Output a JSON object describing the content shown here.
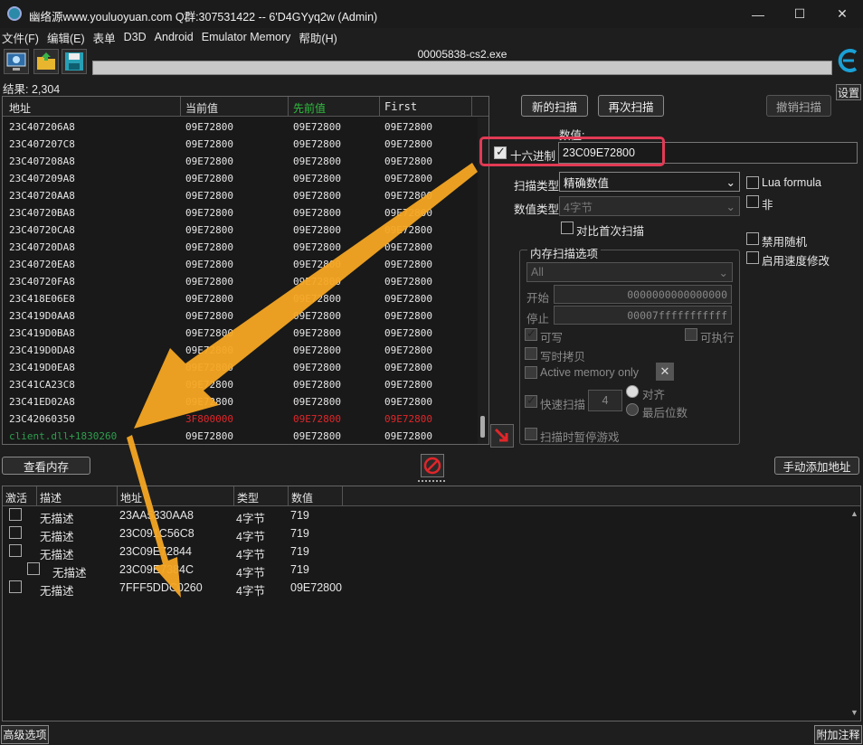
{
  "window": {
    "title": "幽络源www.youluoyuan.com Q群:307531422  --  6'D4GYyq2w (Admin)",
    "minimize": "—",
    "maximize": "☐",
    "close": "✕"
  },
  "menu": [
    "文件(F)",
    "编辑(E)",
    "表单",
    "D3D",
    "Android",
    "Emulator Memory",
    "帮助(H)"
  ],
  "toolbar": {
    "process_name": "00005838-cs2.exe",
    "settings_label": "设置"
  },
  "results": {
    "count_label": "结果: 2,304",
    "columns": [
      "地址",
      "当前值",
      "先前值",
      "First"
    ],
    "rows": [
      {
        "addr": "23C407206A8",
        "cur": "09E72800",
        "prev": "09E72800",
        "first": "09E72800"
      },
      {
        "addr": "23C407207C8",
        "cur": "09E72800",
        "prev": "09E72800",
        "first": "09E72800"
      },
      {
        "addr": "23C407208A8",
        "cur": "09E72800",
        "prev": "09E72800",
        "first": "09E72800"
      },
      {
        "addr": "23C407209A8",
        "cur": "09E72800",
        "prev": "09E72800",
        "first": "09E72800"
      },
      {
        "addr": "23C40720AA8",
        "cur": "09E72800",
        "prev": "09E72800",
        "first": "09E72800"
      },
      {
        "addr": "23C40720BA8",
        "cur": "09E72800",
        "prev": "09E72800",
        "first": "09E72800"
      },
      {
        "addr": "23C40720CA8",
        "cur": "09E72800",
        "prev": "09E72800",
        "first": "09E72800"
      },
      {
        "addr": "23C40720DA8",
        "cur": "09E72800",
        "prev": "09E72800",
        "first": "09E72800"
      },
      {
        "addr": "23C40720EA8",
        "cur": "09E72800",
        "prev": "09E72800",
        "first": "09E72800"
      },
      {
        "addr": "23C40720FA8",
        "cur": "09E72800",
        "prev": "09E72800",
        "first": "09E72800"
      },
      {
        "addr": "23C418E06E8",
        "cur": "09E72800",
        "prev": "09E72800",
        "first": "09E72800"
      },
      {
        "addr": "23C419D0AA8",
        "cur": "09E72800",
        "prev": "09E72800",
        "first": "09E72800"
      },
      {
        "addr": "23C419D0BA8",
        "cur": "09E72800",
        "prev": "09E72800",
        "first": "09E72800"
      },
      {
        "addr": "23C419D0DA8",
        "cur": "09E72800",
        "prev": "09E72800",
        "first": "09E72800"
      },
      {
        "addr": "23C419D0EA8",
        "cur": "09E72800",
        "prev": "09E72800",
        "first": "09E72800"
      },
      {
        "addr": "23C41CA23C8",
        "cur": "09E72800",
        "prev": "09E72800",
        "first": "09E72800"
      },
      {
        "addr": "23C41ED02A8",
        "cur": "09E72800",
        "prev": "09E72800",
        "first": "09E72800"
      },
      {
        "addr": "23C42060350",
        "cur": "3F800000",
        "prev": "09E72800",
        "first": "09E72800",
        "changed": true
      },
      {
        "addr": "client.dll+1830260",
        "cur": "09E72800",
        "prev": "09E72800",
        "first": "09E72800",
        "static": true
      }
    ]
  },
  "scan": {
    "new_scan": "新的扫描",
    "next_scan": "再次扫描",
    "undo_scan": "撤销扫描",
    "value_label": "数值:",
    "hex_label": "十六进制",
    "value": "23C09E72800",
    "scan_type_label": "扫描类型",
    "scan_type": "精确数值",
    "value_type_label": "数值类型",
    "value_type": "4字节",
    "compare_first": "对比首次扫描",
    "lua_formula": "Lua formula",
    "not_label": "非",
    "disable_random": "禁用随机",
    "speedhack": "启用速度修改"
  },
  "memory_options": {
    "group_title": "内存扫描选项",
    "region": "All",
    "start_label": "开始",
    "start": "0000000000000000",
    "stop_label": "停止",
    "stop": "00007fffffffffff",
    "writable": "可写",
    "executable": "可执行",
    "copy_on_write": "写时拷贝",
    "active_memory_only": "Active memory only",
    "fast_scan": "快速扫描",
    "fast_scan_value": "4",
    "alignment": "对齐",
    "last_digits": "最后位数",
    "pause_game": "扫描时暂停游戏"
  },
  "actions": {
    "view_memory": "查看内存",
    "add_address": "手动添加地址"
  },
  "address_list": {
    "columns": [
      "激活",
      "描述",
      "地址",
      "类型",
      "数值"
    ],
    "rows": [
      {
        "desc": "无描述",
        "addr": "23AA5330AA8",
        "type": "4字节",
        "value": "719",
        "indent": false
      },
      {
        "desc": "无描述",
        "addr": "23C091C56C8",
        "type": "4字节",
        "value": "719",
        "indent": false
      },
      {
        "desc": "无描述",
        "addr": "23C09E72844",
        "type": "4字节",
        "value": "719",
        "indent": false
      },
      {
        "desc": "无描述",
        "addr": "23C09E7384C",
        "type": "4字节",
        "value": "719",
        "indent": true
      },
      {
        "desc": "无描述",
        "addr": "7FFF5DDC0260",
        "type": "4字节",
        "value": "09E72800",
        "indent": false
      }
    ]
  },
  "bottom": {
    "advanced": "高级选项",
    "comment": "附加注释"
  },
  "colors": {
    "accent_highlight": "#e23a55",
    "arrow": "#f5a623",
    "static_address": "#2e9e4e",
    "changed_value": "#e0262a",
    "prev_header": "#2fbf3f"
  }
}
